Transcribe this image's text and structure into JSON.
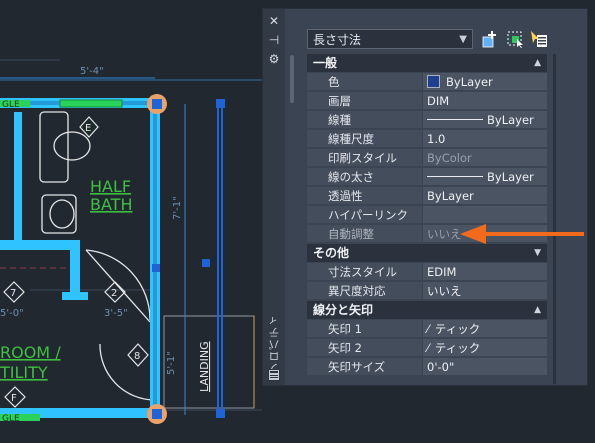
{
  "drawing": {
    "labels": {
      "dim_top": "5'-4\"",
      "gle": "GLE",
      "gle2": "GLE",
      "marker_e": "E",
      "marker_f": "F",
      "half": "HALF",
      "bath": "BATH",
      "dim_vertical": "7'-1\"",
      "dim_d": "5'-1\"",
      "tag_7": "7",
      "tag_2": "2",
      "dim_50": "5'-0\"",
      "dim_35": "3'-5\"",
      "tag_8": "8",
      "room": "ROOM /",
      "utility": "TILITY",
      "landing": "LANDING"
    }
  },
  "palette": {
    "title": "プロパティ",
    "strip": {
      "close": "✕",
      "pin": "⊣",
      "settings": "⚙"
    },
    "selector": {
      "value": "長さ寸法",
      "arrow": "▼"
    },
    "sections": {
      "general": {
        "title": "一般",
        "chevron": "▲",
        "rows": [
          {
            "name": "色",
            "value": "ByLayer"
          },
          {
            "name": "画層",
            "value": "DIM"
          },
          {
            "name": "線種",
            "value": "ByLayer"
          },
          {
            "name": "線種尺度",
            "value": "1.0"
          },
          {
            "name": "印刷スタイル",
            "value": "ByColor"
          },
          {
            "name": "線の太さ",
            "value": "ByLayer"
          },
          {
            "name": "透過性",
            "value": "ByLayer"
          },
          {
            "name": "ハイパーリンク",
            "value": ""
          },
          {
            "name": "自動調整",
            "value": "いいえ"
          }
        ]
      },
      "other": {
        "title": "その他",
        "chevron": "▼",
        "rows": [
          {
            "name": "寸法スタイル",
            "value": "EDIM"
          },
          {
            "name": "異尺度対応",
            "value": "いいえ"
          }
        ]
      },
      "lines": {
        "title": "線分と矢印",
        "chevron": "▲",
        "rows": [
          {
            "name": "矢印 1",
            "value": "ティック"
          },
          {
            "name": "矢印 2",
            "value": "ティック"
          },
          {
            "name": "矢印サイズ",
            "value": "0'-0\""
          }
        ]
      }
    }
  },
  "colors": {
    "accent_arrow": "#f26b1d",
    "wall_highlight": "#2fc4ff",
    "grip": "#1c64d8",
    "green_text": "#3ec13e"
  }
}
